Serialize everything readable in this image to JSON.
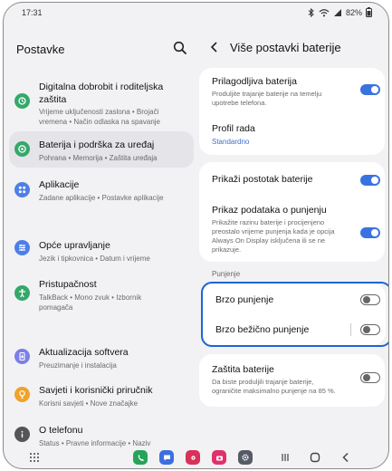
{
  "status": {
    "time": "17:31",
    "battery": "82%"
  },
  "left": {
    "title": "Postavke",
    "items": [
      {
        "title_line1": "Digitalna dobrobit i roditeljska",
        "title_line2": "zaštita",
        "sub1": "Vrijeme uključenosti zaslona • Brojači",
        "sub2": "vremena • Način odlaska na spavanje",
        "icon": "digital-wellbeing-icon",
        "color": "#35a86a"
      },
      {
        "title": "Baterija i podrška za uređaj",
        "sub1": "Pohrana • Memorija • Zaštita uređaja",
        "icon": "battery-care-icon",
        "color": "#35a86a"
      },
      {
        "title": "Aplikacije",
        "sub1": "Zadane aplikacije • Postavke aplikacije",
        "icon": "apps-icon",
        "color": "#4e7fe6"
      },
      {
        "title": "Opće upravljanje",
        "sub1": "Jezik i tipkovnica • Datum i vrijeme",
        "icon": "general-management-icon",
        "color": "#4e7fe6"
      },
      {
        "title": "Pristupačnost",
        "sub1": "TalkBack • Mono zvuk • Izbornik",
        "sub2": "pomagača",
        "icon": "accessibility-icon",
        "color": "#35a86a"
      },
      {
        "title": "Aktualizacija softvera",
        "sub1": "Preuzimanje i instalacija",
        "icon": "software-update-icon",
        "color": "#7b7fe8"
      },
      {
        "title": "Savjeti i korisnički priručnik",
        "sub1": "Korisni savjeti • Nove značajke",
        "icon": "tips-icon",
        "color": "#f0a22a"
      },
      {
        "title": "O telefonu",
        "sub1": "Status • Pravne informacije • Naziv",
        "icon": "about-phone-icon",
        "color": "#555555"
      }
    ]
  },
  "right": {
    "title": "Više postavki baterije",
    "adaptive": {
      "title": "Prilagodljiva baterija",
      "sub1": "Produljite trajanje baterije na temelju",
      "sub2": "upotrebe telefona."
    },
    "profile": {
      "title": "Profil rada",
      "value": "Standardno"
    },
    "show_percent": {
      "title": "Prikaži postotak baterije"
    },
    "charging_info": {
      "title": "Prikaz podataka o punjenju",
      "sub1": "Prikažite razinu baterije i procijenjeno",
      "sub2": "preostalo vrijeme punjenja kada je opcija",
      "sub3": "Always On Display isključena ili se ne",
      "sub4": "prikazuje."
    },
    "section": "Punjenje",
    "fast_charging": {
      "title": "Brzo punjenje"
    },
    "fast_wireless": {
      "title": "Brzo bežično punjenje"
    },
    "protect": {
      "title": "Zaštita baterije",
      "sub1": "Da biste produljili trajanje baterije, ",
      "sub2": "ograničite maksimalno punjenje na 85 %."
    }
  },
  "colors": {
    "accent": "#3a73e0",
    "highlight": "#1b65d6"
  }
}
